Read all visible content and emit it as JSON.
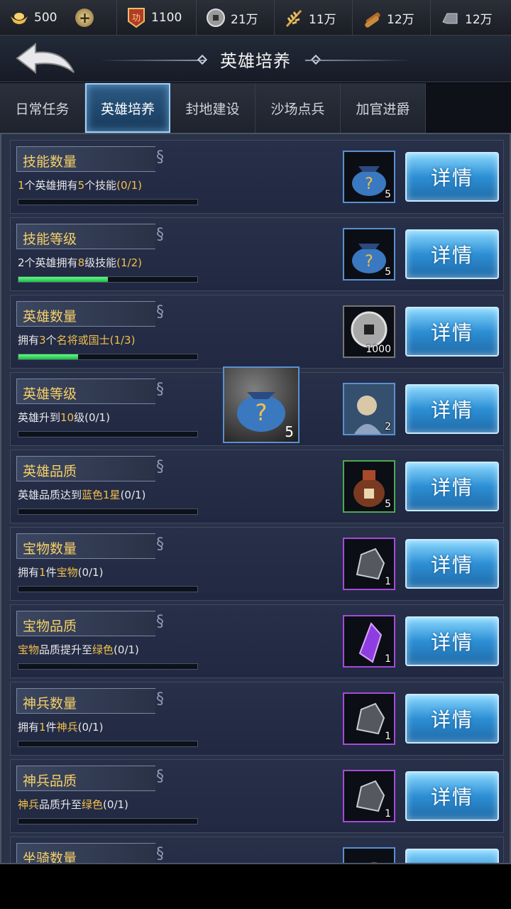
{
  "resources": [
    {
      "icon": "gold-ingot-icon",
      "value": "500"
    },
    {
      "icon": "merit-badge-icon",
      "value": "1100"
    },
    {
      "icon": "copper-coin-icon",
      "value": "21万"
    },
    {
      "icon": "grain-icon",
      "value": "11万"
    },
    {
      "icon": "wood-icon",
      "value": "12万"
    },
    {
      "icon": "iron-icon",
      "value": "12万"
    }
  ],
  "title": "英雄培养",
  "tabs": [
    "日常任务",
    "英雄培养",
    "封地建设",
    "沙场点兵",
    "加官进爵"
  ],
  "active_tab": "英雄培养",
  "detail_label": "详情",
  "items": [
    {
      "title": "技能数量",
      "desc": [
        [
          "1",
          "hl"
        ],
        [
          "个英雄拥有",
          ""
        ],
        [
          "5",
          "hl"
        ],
        [
          "个技能",
          ""
        ],
        [
          "(0/1)",
          "hl"
        ]
      ],
      "progress": 0,
      "reward": "skill-bag-icon",
      "count": "5",
      "frame": "blue"
    },
    {
      "title": "技能等级",
      "desc": [
        [
          "2",
          ""
        ],
        [
          "个英雄拥有",
          ""
        ],
        [
          "8",
          "hl"
        ],
        [
          "级技能",
          ""
        ],
        [
          "(1/2)",
          "hl"
        ]
      ],
      "progress": 0.5,
      "reward": "skill-bag-icon",
      "count": "5",
      "frame": "blue"
    },
    {
      "title": "英雄数量",
      "desc": [
        [
          "拥有",
          ""
        ],
        [
          "3",
          "hl"
        ],
        [
          "个",
          ""
        ],
        [
          "名将或国士",
          "hl"
        ],
        [
          "(1/3)",
          "hl"
        ]
      ],
      "progress": 0.333,
      "reward": "copper-coin-icon",
      "count": "1000",
      "frame": "gray"
    },
    {
      "title": "英雄等级",
      "desc": [
        [
          "英雄升到",
          ""
        ],
        [
          "10",
          "hl"
        ],
        [
          "级(0/1)",
          ""
        ]
      ],
      "progress": 0,
      "reward": "hero-portrait-icon",
      "count": "2",
      "frame": "blue"
    },
    {
      "title": "英雄品质",
      "desc": [
        [
          "英雄品质达到",
          ""
        ],
        [
          "蓝色1星",
          "hl"
        ],
        [
          "(0/1)",
          ""
        ]
      ],
      "progress": 0,
      "reward": "wine-jar-icon",
      "count": "5",
      "frame": "green"
    },
    {
      "title": "宝物数量",
      "desc": [
        [
          "拥有",
          ""
        ],
        [
          "1",
          "hl"
        ],
        [
          "件",
          ""
        ],
        [
          "宝物",
          "hl"
        ],
        [
          "(0/1)",
          ""
        ]
      ],
      "progress": 0,
      "reward": "ore-icon",
      "count": "1",
      "frame": "purple"
    },
    {
      "title": "宝物品质",
      "desc": [
        [
          "宝物",
          "hl"
        ],
        [
          "品质提升至",
          ""
        ],
        [
          "绿色",
          "hl"
        ],
        [
          "(0/1)",
          ""
        ]
      ],
      "progress": 0,
      "reward": "crystal-icon",
      "count": "1",
      "frame": "purple"
    },
    {
      "title": "神兵数量",
      "desc": [
        [
          "拥有",
          ""
        ],
        [
          "1",
          "hl"
        ],
        [
          "件",
          ""
        ],
        [
          "神兵",
          "hl"
        ],
        [
          "(0/1)",
          ""
        ]
      ],
      "progress": 0,
      "reward": "ore-icon",
      "count": "1",
      "frame": "purple"
    },
    {
      "title": "神兵品质",
      "desc": [
        [
          "神兵",
          "hl"
        ],
        [
          "品质升至",
          ""
        ],
        [
          "绿色",
          "hl"
        ],
        [
          "(0/1)",
          ""
        ]
      ],
      "progress": 0,
      "reward": "ore-icon",
      "count": "1",
      "frame": "purple"
    },
    {
      "title": "坐骑数量",
      "desc": [],
      "progress": 0,
      "reward": "mount-icon",
      "count": "",
      "frame": "blue"
    }
  ],
  "popup": {
    "icon": "skill-bag-icon",
    "count": "5"
  }
}
